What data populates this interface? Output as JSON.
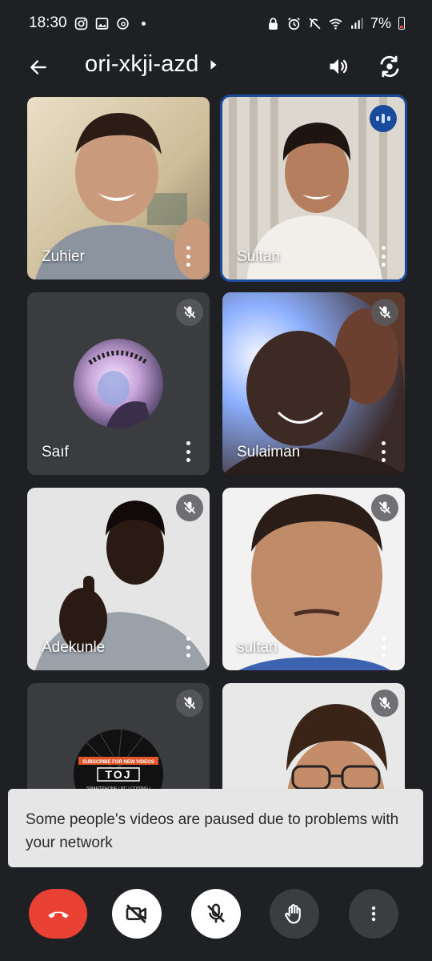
{
  "status_bar": {
    "time": "18:30",
    "battery": "7%"
  },
  "header": {
    "meeting_code": "ori-xkji-azd"
  },
  "participants": [
    {
      "name": "Zuhier",
      "muted": false
    },
    {
      "name": "Sultan",
      "muted": false,
      "speaking": true
    },
    {
      "name": "Saıf",
      "muted": true
    },
    {
      "name": "Sulaiman",
      "muted": true
    },
    {
      "name": "Adekunle",
      "muted": true
    },
    {
      "name": "sultan",
      "muted": true
    },
    {
      "name": "",
      "muted": true
    },
    {
      "name": "",
      "muted": true
    }
  ],
  "avatar_text": {
    "banner": "SUBSCRIBE FOR NEW VIDEOS",
    "logo": "TOJ",
    "tagline": "SMARTPHONE | PC | CODING |"
  },
  "toast": {
    "message": "Some people's videos are paused due to problems with your network"
  },
  "colors": {
    "background": "#1f2023",
    "tile": "#3b3c40",
    "active_outline": "#1a4a9c",
    "end_call": "#e94235",
    "toast_bg": "#e6e6e6"
  },
  "icons": {
    "back": "arrow-left-icon",
    "speaker": "speaker-icon",
    "switch_camera": "switch-camera-icon",
    "end_call": "phone-hangup-icon",
    "camera_off": "camera-off-icon",
    "mic_off": "mic-off-icon",
    "raise_hand": "hand-icon",
    "more": "more-vert-icon"
  }
}
